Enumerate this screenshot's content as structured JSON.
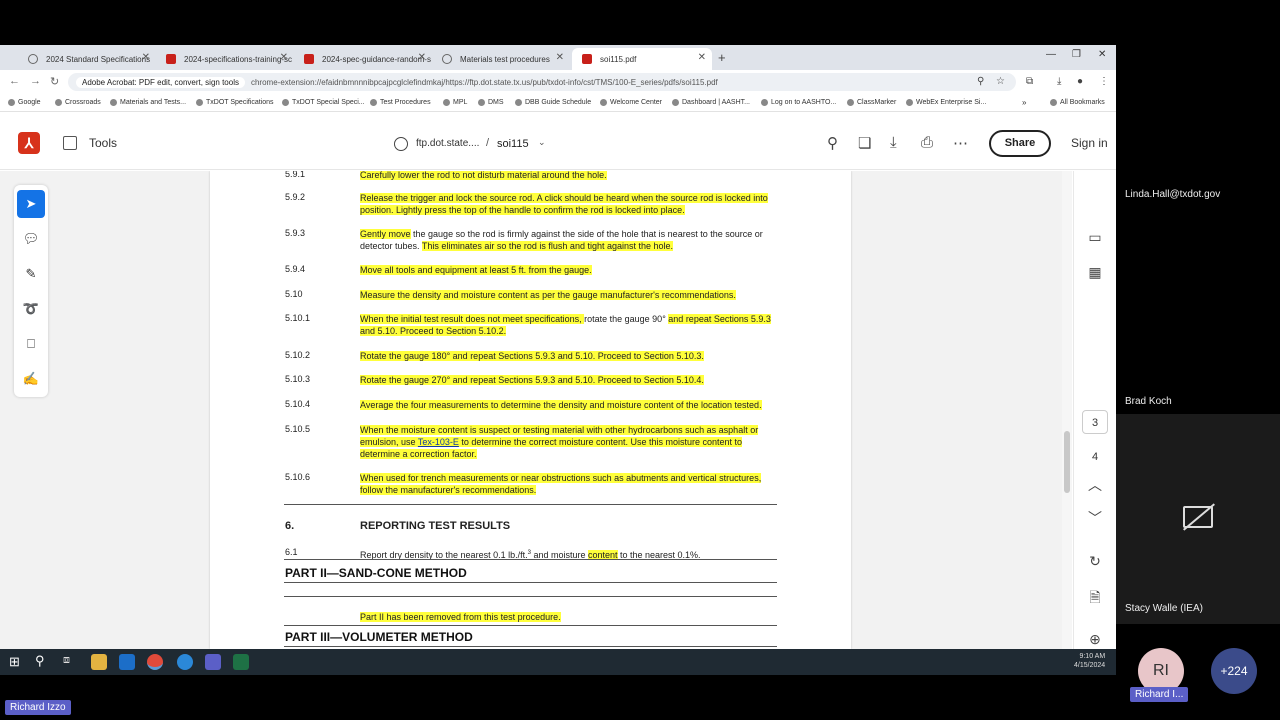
{
  "browser": {
    "tabs": [
      {
        "label": "2024 Standard Specifications",
        "icon": "globe-icon"
      },
      {
        "label": "2024-specifications-training-sc",
        "icon": "pdf-icon"
      },
      {
        "label": "2024-spec-guidance-random-s",
        "icon": "pdf-icon"
      },
      {
        "label": "Materials test procedures",
        "icon": "globe-icon"
      },
      {
        "label": "soi115.pdf",
        "icon": "pdf-icon"
      }
    ],
    "site_chip": "Adobe Acrobat: PDF edit, convert, sign tools",
    "url": "chrome-extension://efaidnbmnnnibpcajpcglclefindmkaj/https://ftp.dot.state.tx.us/pub/txdot-info/cst/TMS/100-E_series/pdfs/soi115.pdf",
    "bookmarks": [
      "Google",
      "Crossroads",
      "Materials and Tests...",
      "TxDOT Specifications",
      "TxDOT Special Speci...",
      "Test Procedures",
      "MPL",
      "DMS",
      "DBB Guide Schedule",
      "Welcome Center",
      "Dashboard | AASHT...",
      "Log on to AASHTO...",
      "ClassMarker",
      "WebEx Enterprise Si..."
    ],
    "all_bookmarks": "All Bookmarks"
  },
  "acrobat": {
    "tools_label": "Tools",
    "domain": "ftp.dot.state....",
    "doc_name": "soi115",
    "share_label": "Share",
    "signin_label": "Sign in",
    "page_numbers": [
      "3",
      "4"
    ]
  },
  "document": {
    "cut_line": "5.9.1",
    "cut_text": "Carefully lower the rod to not disturb material around the hole.",
    "steps": [
      {
        "num": "5.9.2",
        "text": "Release the trigger and lock the source rod. A click should be heard when the source rod is locked into position. Lightly press the top of the handle to confirm the rod is locked into place."
      },
      {
        "num": "5.9.3",
        "text_a": "Gently move",
        "text_b": " the gauge so the rod is firmly against the side of the hole that is nearest to the source or detector tubes. ",
        "text_c": "This eliminates air so the rod is flush and tight against the hole."
      },
      {
        "num": "5.9.4",
        "text": "Move all tools and equipment at least 5 ft. from the gauge."
      },
      {
        "num": "5.10",
        "text": "Measure the density and moisture content as per the gauge manufacturer's recommendations."
      },
      {
        "num": "5.10.1",
        "text_a": "When the initial test result does not meet specifications, ",
        "text_b": "rotate the gauge 90° ",
        "text_c": "and repeat Sections 5.9.3 and 5.10. Proceed to Section 5.10.2."
      },
      {
        "num": "5.10.2",
        "text": "Rotate the gauge 180° and repeat Sections 5.9.3 and 5.10. Proceed to Section 5.10.3."
      },
      {
        "num": "5.10.3",
        "text": "Rotate the gauge 270° and repeat Sections 5.9.3 and 5.10. Proceed to Section 5.10.4."
      },
      {
        "num": "5.10.4",
        "text": "Average the four measurements to determine the density and moisture content of the location tested."
      },
      {
        "num": "5.10.5",
        "text_a": "When the moisture content is suspect or testing material with other hydrocarbons such as asphalt or emulsion, use ",
        "link": "Tex-103-E",
        "text_c": " to determine the correct moisture content. Use this moisture content to determine a correction factor."
      },
      {
        "num": "5.10.6",
        "text": "When used for trench measurements or near obstructions such as abutments and vertical structures, follow the manufacturer's recommendations."
      }
    ],
    "section6_num": "6.",
    "section6_title": "REPORTING TEST RESULTS",
    "s61_num": "6.1",
    "s61_a": "Report dry density to the nearest 0.1 lb./ft.",
    "s61_sup": "3",
    "s61_b": " and moisture ",
    "s61_c": "content",
    "s61_d": " to the nearest 0.1%.",
    "part2": "PART II—SAND-CONE METHOD",
    "part2_note": "Part II has been removed from this test procedure.",
    "part3": "PART III—VOLUMETER METHOD"
  },
  "taskbar": {
    "time": "9:10 AM",
    "date": "4/15/2024"
  },
  "meeting": {
    "participant_1": "Linda.Hall@txdot.gov",
    "participant_2": "Brad Koch",
    "participant_3": "Stacy Walle (IEA)",
    "self_initials": "RI",
    "self_label": "Richard I...",
    "more_count": "+224",
    "presenter": "Richard Izzo"
  },
  "colors": {
    "highlight": "#ffff3b",
    "acrobat_red": "#d7321b",
    "select_blue": "#1473e6",
    "teams_purple": "#5b5fc7"
  }
}
